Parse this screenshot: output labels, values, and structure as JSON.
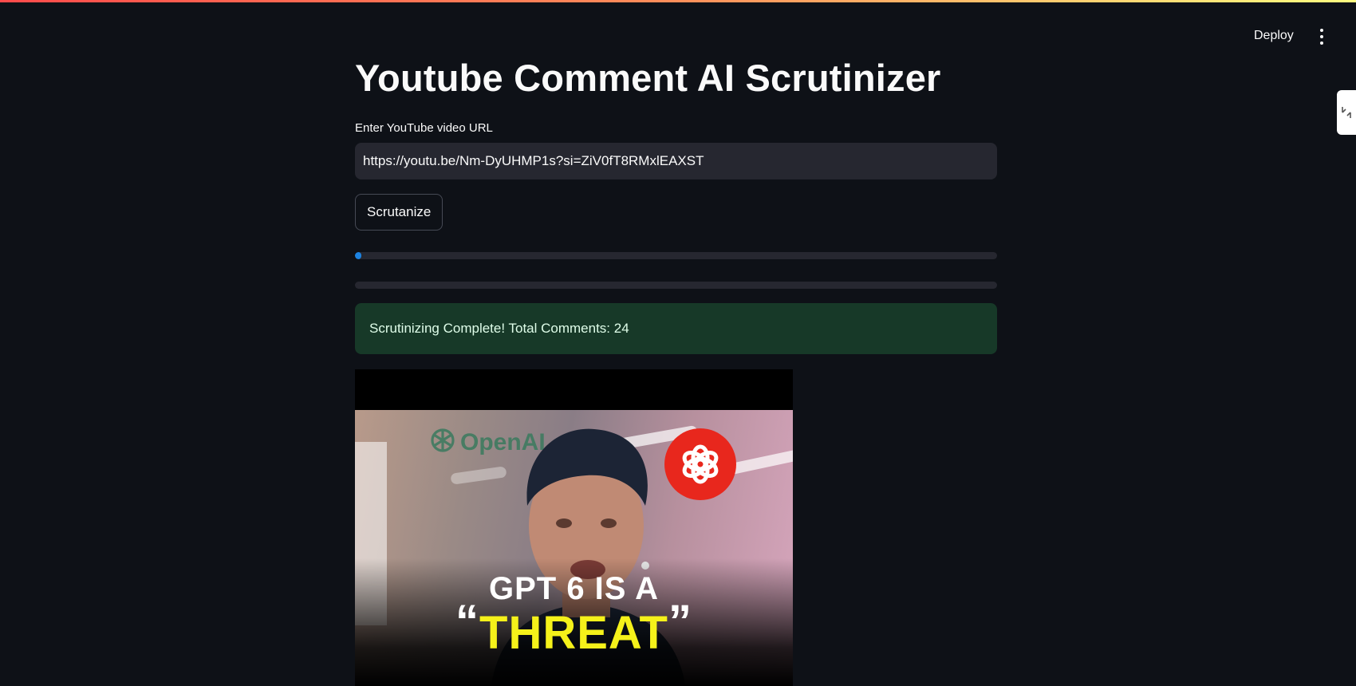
{
  "header": {
    "deploy_label": "Deploy",
    "menu_icon": "more-vertical-icon"
  },
  "page": {
    "title": "Youtube Comment AI Scrutinizer"
  },
  "url_input": {
    "label": "Enter YouTube video URL",
    "value": "https://youtu.be/Nm-DyUHMP1s?si=ZiV0fT8RMxlEAXST"
  },
  "actions": {
    "scrutanize_label": "Scrutanize"
  },
  "progress": [
    {
      "value": 0.01,
      "color": "#1c83e1"
    },
    {
      "value": 0,
      "color": "#1c83e1"
    }
  ],
  "status": {
    "message": "Scrutinizing Complete! Total Comments: 24",
    "color": "#173928"
  },
  "thumbnail": {
    "brand_text": "OpenAI",
    "line1": "GPT 6 IS A",
    "open_quote": "“",
    "line2": "THREAT",
    "close_quote": "”"
  },
  "colors": {
    "background": "#0e1117",
    "input_bg": "#262730",
    "accent": "#1c83e1",
    "success_bg": "#173928"
  }
}
